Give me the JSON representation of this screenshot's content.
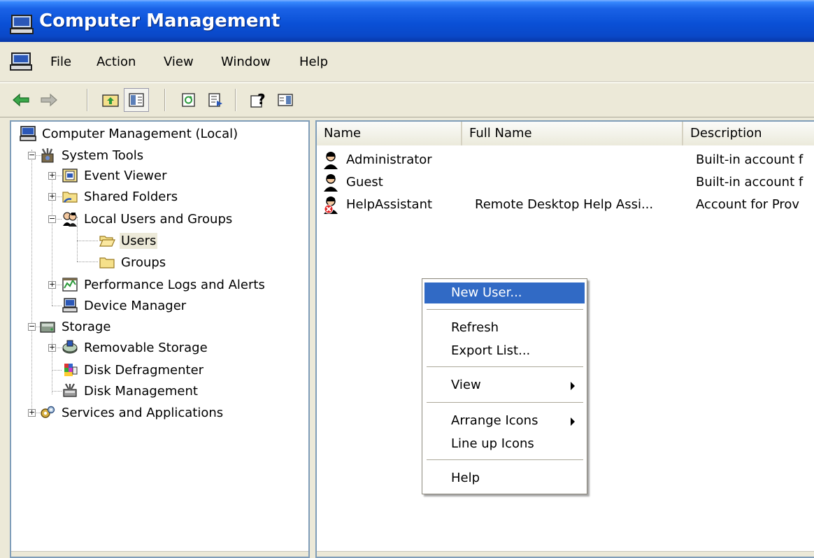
{
  "window": {
    "title": "Computer Management"
  },
  "menu": {
    "items": [
      "File",
      "Action",
      "View",
      "Window",
      "Help"
    ]
  },
  "toolbar": {
    "buttons": [
      "back-icon",
      "forward-icon",
      "up-folder-icon",
      "show-hide-tree-icon",
      "refresh-icon",
      "export-list-icon",
      "help-icon",
      "action-pane-icon"
    ]
  },
  "tree": {
    "root": "Computer Management (Local)",
    "system_tools": "System Tools",
    "event_viewer": "Event Viewer",
    "shared_folders": "Shared Folders",
    "local_users_groups": "Local Users and Groups",
    "users": "Users",
    "groups": "Groups",
    "perf_logs": "Performance Logs and Alerts",
    "device_manager": "Device Manager",
    "storage": "Storage",
    "removable_storage": "Removable Storage",
    "disk_defrag": "Disk Defragmenter",
    "disk_management": "Disk Management",
    "services_apps": "Services and Applications"
  },
  "list": {
    "columns": [
      "Name",
      "Full Name",
      "Description"
    ],
    "rows": [
      {
        "name": "Administrator",
        "full_name": "",
        "description": "Built-in account f",
        "disabled": false
      },
      {
        "name": "Guest",
        "full_name": "",
        "description": "Built-in account f",
        "disabled": false
      },
      {
        "name": "HelpAssistant",
        "full_name": "Remote Desktop Help Assi...",
        "description": "Account for Prov",
        "disabled": true
      }
    ]
  },
  "context_menu": {
    "items": [
      "New User...",
      "Refresh",
      "Export List...",
      "View",
      "Arrange Icons",
      "Line up Icons",
      "Help"
    ],
    "highlighted": "New User..."
  },
  "colors": {
    "titlebar": "#0a50d6",
    "highlight": "#316ac5",
    "chrome": "#ece9d8"
  }
}
